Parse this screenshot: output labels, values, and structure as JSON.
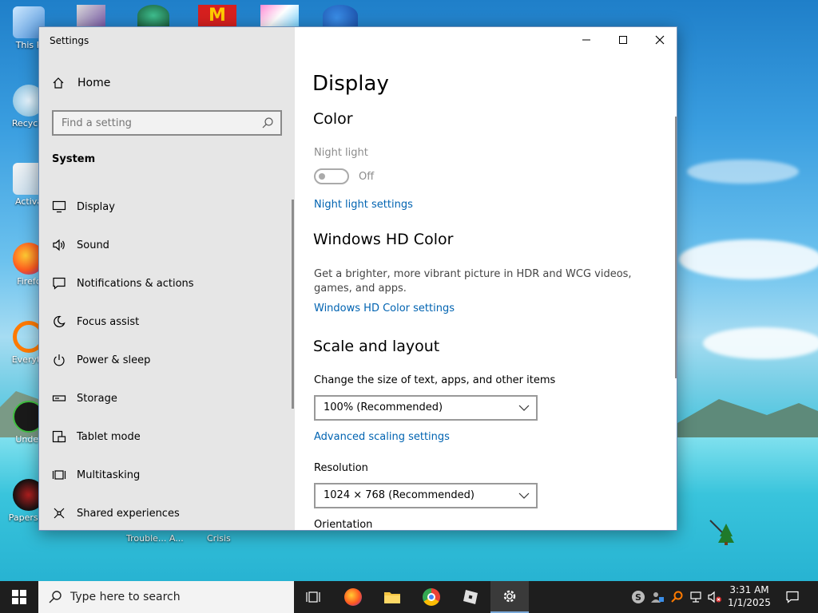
{
  "desktop": {
    "icons": [
      {
        "label": "This P"
      },
      {
        "label": "Recycle"
      },
      {
        "label": "Activa"
      },
      {
        "label": "Firefc"
      },
      {
        "label": "Everyth"
      },
      {
        "label": "Under"
      },
      {
        "label": "Papers, P"
      }
    ],
    "bottom_labels": [
      "Trouble... A...",
      "Crisis"
    ]
  },
  "window": {
    "title": "Settings",
    "controls": {
      "minimize": "minimize",
      "maximize": "maximize",
      "close": "close"
    }
  },
  "sidebar": {
    "home_label": "Home",
    "search_placeholder": "Find a setting",
    "section": "System",
    "items": [
      {
        "label": "Display",
        "icon": "monitor-icon"
      },
      {
        "label": "Sound",
        "icon": "speaker-icon"
      },
      {
        "label": "Notifications & actions",
        "icon": "notification-icon"
      },
      {
        "label": "Focus assist",
        "icon": "moon-icon"
      },
      {
        "label": "Power & sleep",
        "icon": "power-icon"
      },
      {
        "label": "Storage",
        "icon": "storage-icon"
      },
      {
        "label": "Tablet mode",
        "icon": "tablet-icon"
      },
      {
        "label": "Multitasking",
        "icon": "multitask-icon"
      },
      {
        "label": "Shared experiences",
        "icon": "share-icon"
      }
    ]
  },
  "content": {
    "title": "Display",
    "color": {
      "heading": "Color",
      "night_light_label": "Night light",
      "night_light_state": "Off",
      "night_light_link": "Night light settings"
    },
    "hd_color": {
      "heading": "Windows HD Color",
      "description": "Get a brighter, more vibrant picture in HDR and WCG videos, games, and apps.",
      "link": "Windows HD Color settings"
    },
    "scale": {
      "heading": "Scale and layout",
      "size_label": "Change the size of text, apps, and other items",
      "size_value": "100% (Recommended)",
      "advanced_link": "Advanced scaling settings",
      "resolution_label": "Resolution",
      "resolution_value": "1024 × 768 (Recommended)",
      "orientation_label": "Orientation"
    }
  },
  "taskbar": {
    "search_placeholder": "Type here to search",
    "time": "3:31 AM",
    "date": "1/1/2025"
  },
  "colors": {
    "accent_link": "#0063b1",
    "sidebar_bg": "#e6e6e6",
    "taskbar_bg": "#1e1e1e"
  }
}
